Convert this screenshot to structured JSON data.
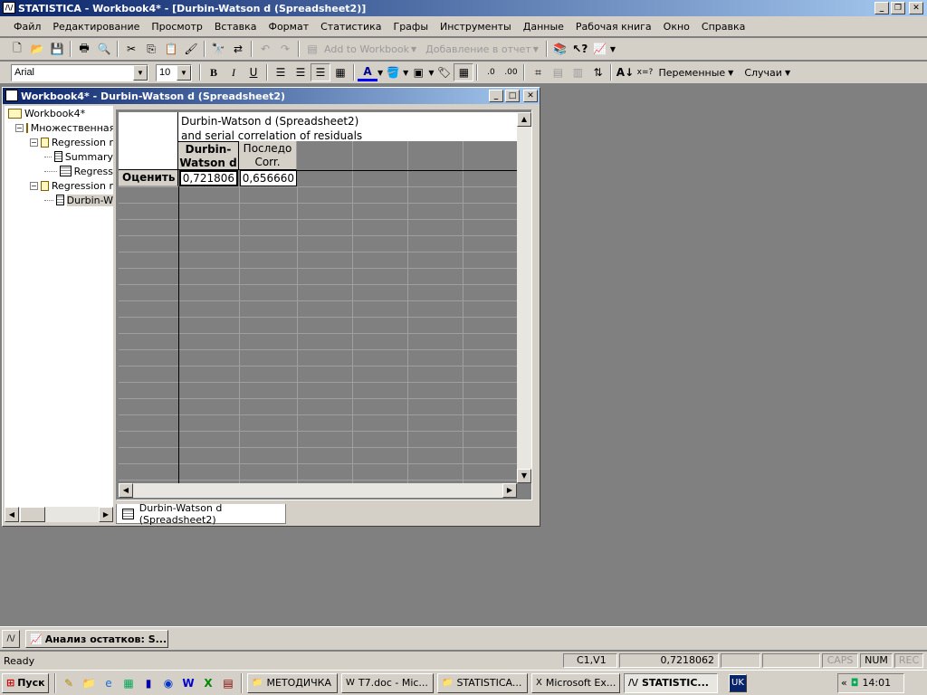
{
  "app": {
    "title": "STATISTICA - Workbook4* - [Durbin-Watson d (Spreadsheet2)]"
  },
  "menu": [
    "Файл",
    "Редактирование",
    "Просмотр",
    "Вставка",
    "Формат",
    "Статистика",
    "Графы",
    "Инструменты",
    "Данные",
    "Рабочая книга",
    "Окно",
    "Справка"
  ],
  "toolbar": {
    "add_to_workbook": "Add to Workbook",
    "add_to_report": "Добавление в отчет",
    "font": "Arial",
    "font_size": "10",
    "variables": "Переменные",
    "cases": "Случаи"
  },
  "workbook": {
    "title": "Workbook4* - Durbin-Watson d (Spreadsheet2)",
    "tree": [
      "Workbook4*",
      "Множественная",
      "Regression r",
      "Summary",
      "Regress",
      "Regression r",
      "Durbin-W"
    ]
  },
  "sheet": {
    "title_line1": "Durbin-Watson d (Spreadsheet2)",
    "title_line2": "and serial correlation of residuals",
    "col1": "Durbin-Watson d",
    "col2": "Последо Corr.",
    "row_label": "Оценить",
    "val1": "0,721806",
    "val2": "0,656660",
    "tab": "Durbin-Watson d (Spreadsheet2)"
  },
  "minimized": "Анализ остатков: S...",
  "status": {
    "ready": "Ready",
    "cell": "C1,V1",
    "value": "0,7218062",
    "caps": "CAPS",
    "num": "NUM",
    "rec": "REC"
  },
  "taskbar": {
    "start": "Пуск",
    "tasks": [
      "МЕТОДИЧКА",
      "T7.doc - Mic...",
      "STATISTICA...",
      "Microsoft Ex...",
      "STATISTIC..."
    ],
    "lang": "UK",
    "time": "14:01"
  }
}
